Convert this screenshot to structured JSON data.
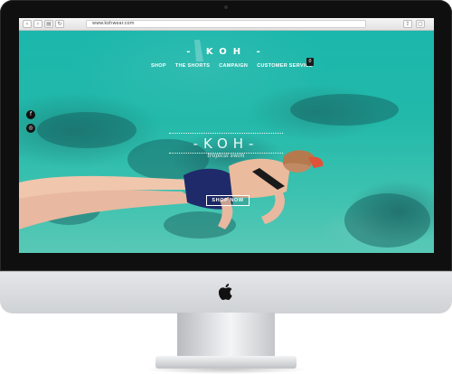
{
  "browser": {
    "url": "www.kohwear.com",
    "back_label": "‹",
    "forward_label": "›",
    "reload_label": "↻",
    "share_label": "⇪",
    "tabs_label": "▢",
    "icons": [
      "back-icon",
      "forward-icon",
      "sidebar-icon",
      "share-icon",
      "reload-icon",
      "tabs-icon",
      "add-tab-icon"
    ]
  },
  "site": {
    "title": "- KOH -",
    "nav": [
      {
        "label": "SHOP"
      },
      {
        "label": "THE SHORTS"
      },
      {
        "label": "CAMPAIGN"
      },
      {
        "label": "CUSTOMER SERVICE"
      }
    ],
    "cart_count": "0",
    "social": {
      "facebook_glyph": "f",
      "instagram_glyph": "◎"
    },
    "hero": {
      "logo_text": "-KOH-",
      "logo_subtitle": "tropical swim",
      "cta_label": "SHOP NOW"
    }
  },
  "colors": {
    "water": "#1bb3aa",
    "bezel": "#0f0f10",
    "chin": "#d9dcdf"
  }
}
